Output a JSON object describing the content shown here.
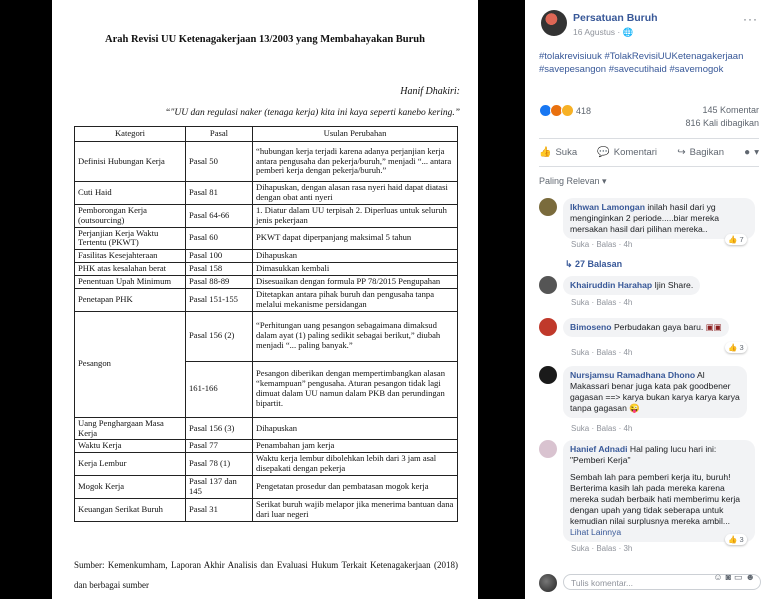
{
  "document": {
    "title": "Arah Revisi UU Ketenagakerjaan 13/2003 yang Membahayakan Buruh",
    "author": "Hanif Dhakiri:",
    "quote": "“\"UU dan regulasi naker (tenaga kerja) kita ini kaya seperti kanebo kering.”",
    "headers": [
      "Kategori",
      "Pasal",
      "Usulan Perubahan"
    ],
    "rows": [
      {
        "kategori": "Definisi Hubungan Kerja",
        "pasal": "Pasal 50",
        "usulan": "“hubungan kerja terjadi karena adanya perjanjian kerja antara pengusaha dan pekerja/buruh,” menjadi “... antara pemberi kerja dengan pekerja/buruh.”"
      },
      {
        "kategori": "Cuti Haid",
        "pasal": "Pasal 81",
        "usulan": "Dihapuskan, dengan alasan rasa nyeri haid dapat diatasi dengan obat anti nyeri"
      },
      {
        "kategori": "Pemborongan Kerja (outsourcing)",
        "pasal": "Pasal 64-66",
        "usulan": "1. Diatur dalam UU terpisah 2. Diperluas untuk seluruh jenis pekerjaan"
      },
      {
        "kategori": "Perjanjian Kerja Waktu Tertentu (PKWT)",
        "pasal": "Pasal 60",
        "usulan": "PKWT dapat diperpanjang maksimal 5 tahun"
      },
      {
        "kategori": "Fasilitas Kesejahteraan",
        "pasal": "Pasal 100",
        "usulan": "Dihapuskan"
      },
      {
        "kategori": "PHK atas kesalahan berat",
        "pasal": "Pasal 158",
        "usulan": "Dimasukkan kembali"
      },
      {
        "kategori": "Penentuan Upah Minimum",
        "pasal": "Pasal 88-89",
        "usulan": "Disesuaikan dengan formula PP 78/2015 Pengupahan"
      },
      {
        "kategori": "Penetapan PHK",
        "pasal": "Pasal 151-155",
        "usulan": "Ditetapkan antara pihak buruh dan pengusaha tanpa melalui mekanisme persidangan"
      },
      {
        "kategori": "Uang Penghargaan Masa Kerja",
        "pasal": "Pasal 156 (3)",
        "usulan": "Dihapuskan"
      },
      {
        "kategori": "Waktu Kerja",
        "pasal": "Pasal 77",
        "usulan": "Penambahan jam kerja"
      },
      {
        "kategori": "Kerja Lembur",
        "pasal": "Pasal 78 (1)",
        "usulan": "Waktu kerja lembur dibolehkan lebih dari 3 jam asal disepakati dengan pekerja"
      },
      {
        "kategori": "Mogok Kerja",
        "pasal": "Pasal 137 dan 145",
        "usulan": "Pengetatan prosedur dan pembatasan mogok kerja"
      },
      {
        "kategori": "Keuangan Serikat Buruh",
        "pasal": "Pasal 31",
        "usulan": "Serikat buruh wajib melapor jika menerima bantuan dana dari luar negeri"
      }
    ],
    "pesangon": {
      "kategori": "Pesangon",
      "pasal_a": "Pasal 156 (2)",
      "usulan_a": "“Perhitungan uang pesangon sebagaimana dimaksud dalam ayat (1) paling sedikit sebagai berikut,” diubah menjadi “... paling banyak.”",
      "pasal_b": "161-166",
      "usulan_b": "Pesangon diberikan dengan mempertimbangkan alasan “kemampuan” pengusaha. Aturan pesangon tidak lagi dimuat dalam UU namun dalam PKB dan perundingan bipartit."
    },
    "source": "Sumber: Kemenkumham, Laporan Akhir Analisis dan Evaluasi Hukum Terkait Ketenagakerjaan (2018) dan berbagai sumber"
  },
  "post": {
    "page_name": "Persatuan Buruh",
    "time": "16 Agustus · ",
    "hashtags": "#tolakrevisiuuk #TolakRevisiUUKetenagakerjaan #savepesangon #savecutihaid #savemogok",
    "reaction_count": "418",
    "comments_count": "145 Komentar",
    "shares_count": "816 Kali dibagikan",
    "action_like": "Suka",
    "action_comment": "Komentari",
    "action_share": "Bagikan",
    "sort_label": "Paling Relevan ▾",
    "more_glyph": "···"
  },
  "comments": [
    {
      "name": "Ikhwan Lamongan",
      "text": "inilah hasil dari yg menginginkan 2 periode.....biar mereka mersakan hasil dari pilihan mereka..",
      "meta": "Suka · Balas · 4h",
      "reacts": "7"
    },
    {
      "name": "Khairuddin Harahap",
      "text": "Ijin Share.",
      "meta": "Suka · Balas · 4h",
      "reacts": ""
    },
    {
      "name": "Bimoseno",
      "text": "Perbudakan gaya baru.",
      "meta": "Suka · Balas · 4h",
      "reacts": "3"
    },
    {
      "name": "Nursjamsu Ramadhana Dhono",
      "text": "Al Makassari benar juga kata pak goodbener gagasan ==> karya bukan karya karya karya tanpa gagasan",
      "meta": "Suka · Balas · 4h",
      "reacts": ""
    },
    {
      "name": "Hanief Adnadi",
      "text": "Hal paling lucu hari ini: \"Pemberi Kerja\"",
      "text2": "Sembah lah para pemberi kerja itu, buruh! Berterima kasih lah pada mereka karena mereka sudah berbaik hati memberimu kerja dengan upah yang tidak seberapa untuk kemudian nilai surplusnya mereka ambil... ",
      "more": "Lihat Lainnya",
      "meta": "Suka · Balas · 3h",
      "reacts": "3"
    }
  ],
  "replies_label": "↳ 27 Balasan",
  "input_placeholder": "Tulis komentar...",
  "colors": {
    "link": "#385898",
    "meta": "#90949c",
    "bubble": "#f2f3f5"
  }
}
